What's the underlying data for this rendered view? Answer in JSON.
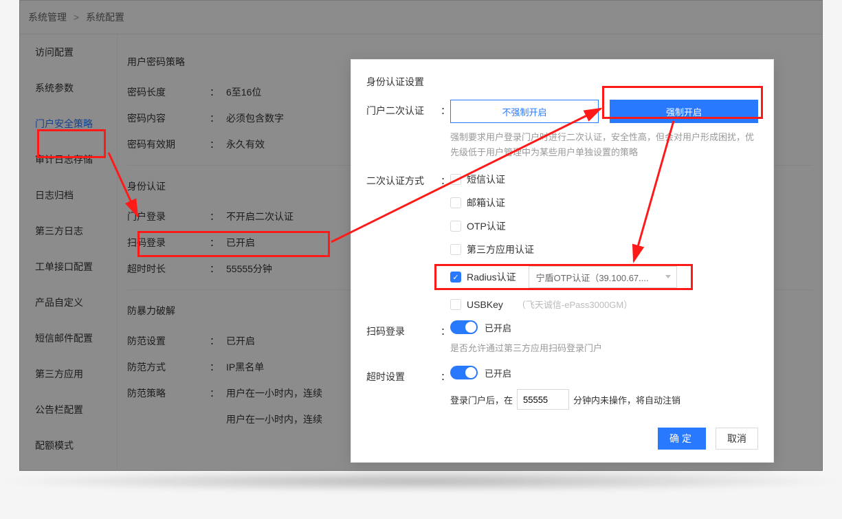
{
  "breadcrumb": {
    "a": "系统管理",
    "b": "系统配置"
  },
  "sidebar": {
    "items": [
      {
        "label": "访问配置"
      },
      {
        "label": "系统参数"
      },
      {
        "label": "门户安全策略",
        "active": true
      },
      {
        "label": "审计日志存储"
      },
      {
        "label": "日志归档"
      },
      {
        "label": "第三方日志"
      },
      {
        "label": "工单接口配置"
      },
      {
        "label": "产品自定义"
      },
      {
        "label": "短信邮件配置"
      },
      {
        "label": "第三方应用"
      },
      {
        "label": "公告栏配置"
      },
      {
        "label": "配额模式"
      }
    ]
  },
  "main": {
    "pwd_policy_title": "用户密码策略",
    "pwd_len_k": "密码长度",
    "pwd_len_v": "6至16位",
    "pwd_content_k": "密码内容",
    "pwd_content_v": "必须包含数字",
    "pwd_expire_k": "密码有效期",
    "pwd_expire_v": "永久有效",
    "id_auth_title": "身份认证",
    "portal_login_k": "门户登录",
    "portal_login_v": "不开启二次认证",
    "scan_login_k": "扫码登录",
    "scan_login_v": "已开启",
    "timeout_k": "超时时长",
    "timeout_v": "55555分钟",
    "brute_title": "防暴力破解",
    "guard_setting_k": "防范设置",
    "guard_setting_v": "已开启",
    "guard_method_k": "防范方式",
    "guard_method_v": "IP黑名单",
    "guard_policy_k": "防范策略",
    "guard_policy_v": "用户在一小时内，连续",
    "extra_line": "用户在一小时内，连续"
  },
  "dialog": {
    "title": "身份认证设置",
    "sec_auth_k": "门户二次认证",
    "seg_left": "不强制开启",
    "seg_right": "强制开启",
    "hint": "强制要求用户登录门户时进行二次认证，安全性高，但会对用户形成困扰，优先级低于用户管理中为某些用户单独设置的策略",
    "method_k": "二次认证方式",
    "chk_sms": "短信认证",
    "chk_email": "邮箱认证",
    "chk_otp": "OTP认证",
    "chk_third": "第三方应用认证",
    "chk_radius": "Radius认证",
    "radius_select": "宁盾OTP认证（39.100.67....",
    "chk_usb": "USBKey",
    "usb_sub": "（飞天诚信-ePass3000GM）",
    "scan_k": "扫码登录",
    "scan_on": "已开启",
    "scan_hint": "是否允许通过第三方应用扫码登录门户",
    "timeout_k": "超时设置",
    "timeout_on": "已开启",
    "t_pre": "登录门户后，在",
    "t_val": "55555",
    "t_post": "分钟内未操作，将自动注销",
    "ok": "确定",
    "cancel": "取消"
  },
  "colon": "："
}
